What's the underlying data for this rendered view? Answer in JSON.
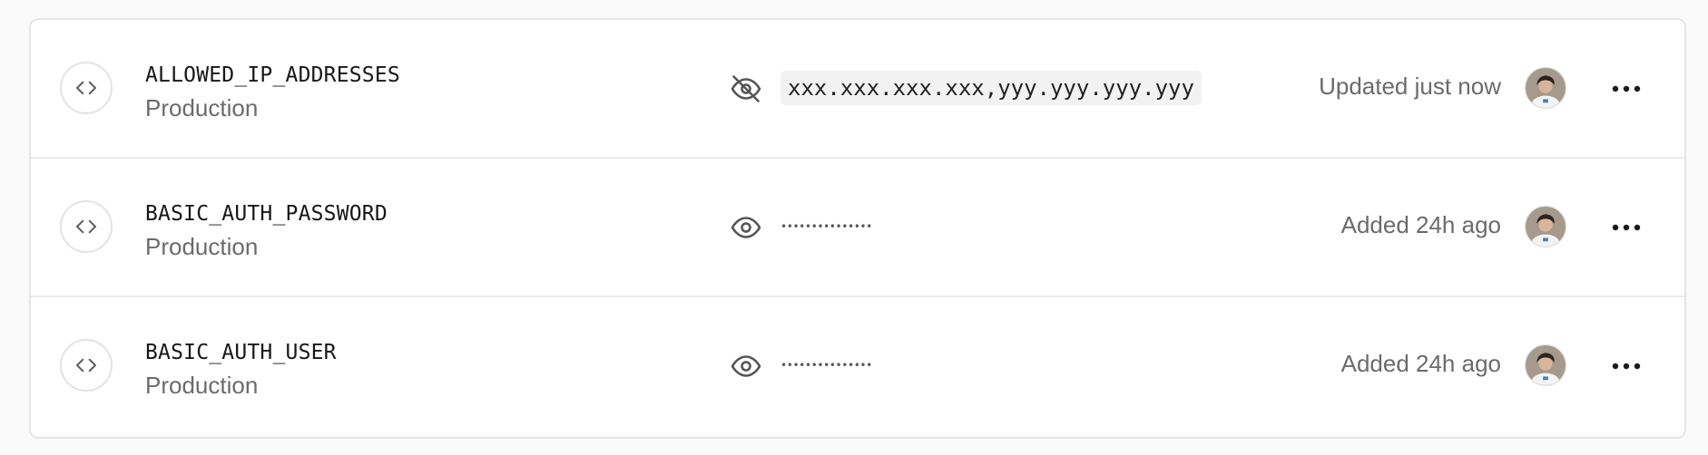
{
  "env_vars": [
    {
      "name": "ALLOWED_IP_ADDRESSES",
      "environment": "Production",
      "visibility_icon": "eye-off-icon",
      "value": "xxx.xxx.xxx.xxx,yyy.yyy.yyy.yyy",
      "status": "Updated just now"
    },
    {
      "name": "BASIC_AUTH_PASSWORD",
      "environment": "Production",
      "visibility_icon": "eye-icon",
      "value": "•••••••••••••••",
      "status": "Added 24h ago"
    },
    {
      "name": "BASIC_AUTH_USER",
      "environment": "Production",
      "visibility_icon": "eye-icon",
      "value": "•••••••••••••••",
      "status": "Added 24h ago"
    }
  ],
  "icons": {
    "row": "code-brackets-icon",
    "menu": "more-horizontal-icon",
    "avatar": "user-avatar"
  },
  "colors": {
    "text_primary": "#171717",
    "text_secondary": "#6b6b6b",
    "border": "#e5e5e5",
    "value_bg": "#f2f2f2"
  }
}
